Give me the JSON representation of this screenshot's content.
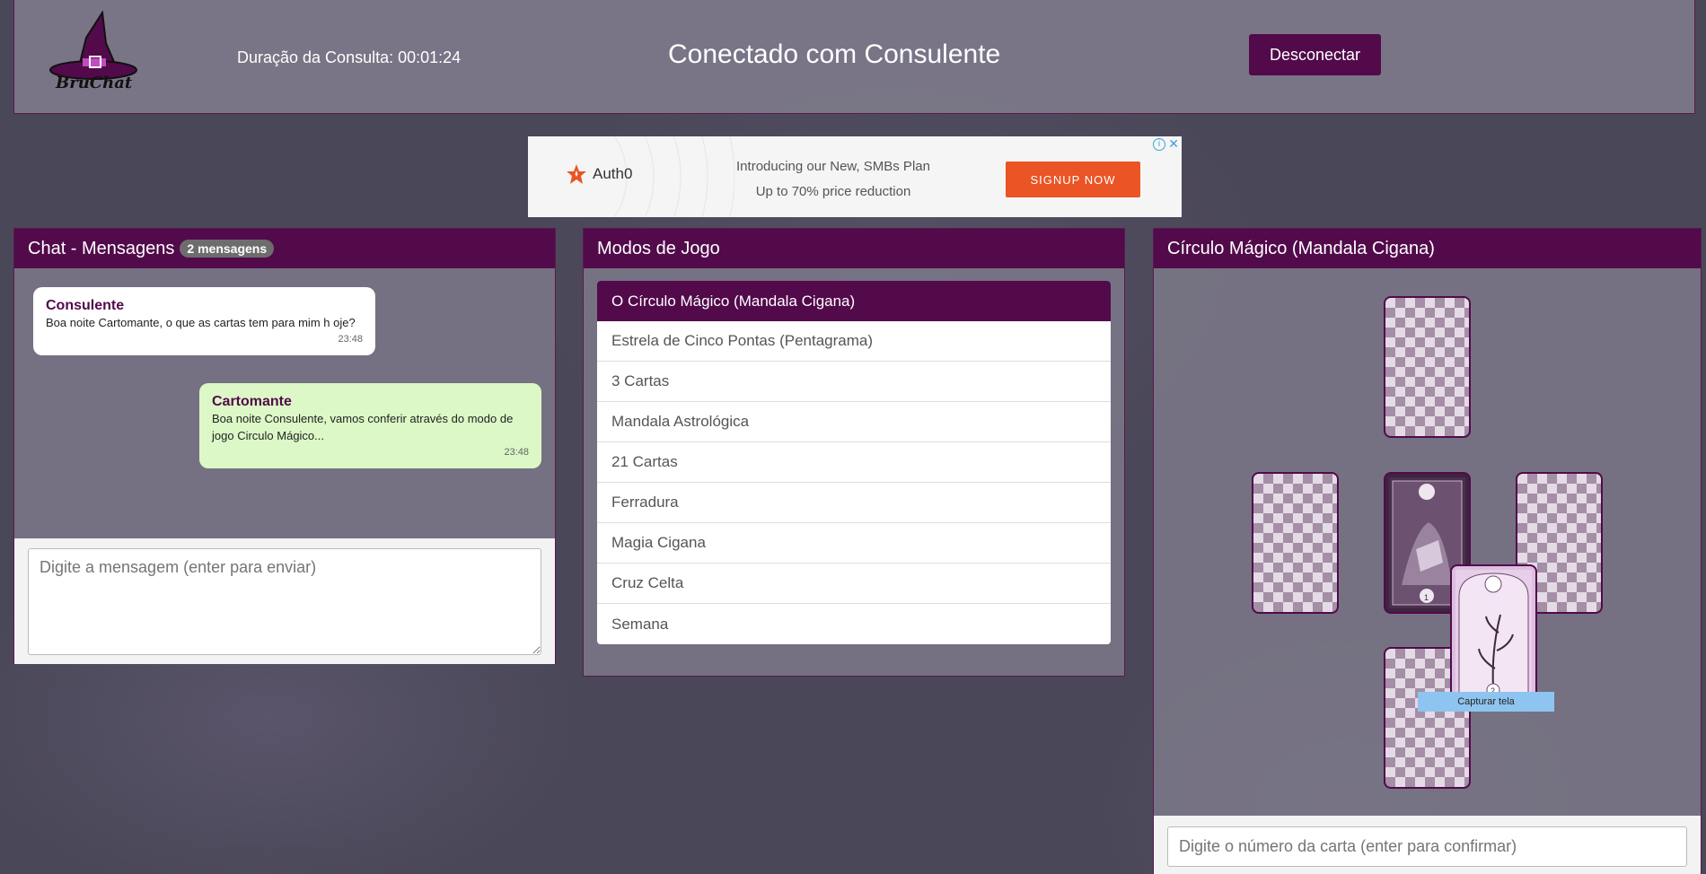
{
  "header": {
    "logo_text": "BruChat",
    "duration_label": "Duração da Consulta: 00:01:24",
    "title": "Conectado com Consulente",
    "disconnect_label": "Desconectar"
  },
  "ad": {
    "brand": "Auth0",
    "line1": "Introducing our New, SMBs Plan",
    "line2": "Up to 70% price reduction",
    "cta": "SIGNUP NOW",
    "brand_color": "#eb5424"
  },
  "chat": {
    "title": "Chat - Mensagens",
    "badge": "2 mensagens",
    "messages": [
      {
        "author": "Consulente",
        "text": "Boa noite Cartomante, o que as cartas tem para mim h oje?",
        "time": "23:48"
      },
      {
        "author": "Cartomante",
        "text": "Boa noite Consulente, vamos conferir através do modo de jogo Circulo Mágico...",
        "time": "23:48"
      }
    ],
    "input_placeholder": "Digite a mensagem (enter para enviar)"
  },
  "modes": {
    "title": "Modos de Jogo",
    "items": [
      {
        "label": "O Círculo Mágico (Mandala Cigana)",
        "active": true
      },
      {
        "label": "Estrela de Cinco Pontas (Pentagrama)",
        "active": false
      },
      {
        "label": "3 Cartas",
        "active": false
      },
      {
        "label": "Mandala Astrológica",
        "active": false
      },
      {
        "label": "21 Cartas",
        "active": false
      },
      {
        "label": "Ferradura",
        "active": false
      },
      {
        "label": "Magia Cigana",
        "active": false
      },
      {
        "label": "Cruz Celta",
        "active": false
      },
      {
        "label": "Semana",
        "active": false
      }
    ]
  },
  "board": {
    "title": "Círculo Mágico (Mandala Cigana)",
    "card1_number": "1",
    "card2_number": "2",
    "capture_label": "Capturar tela",
    "input_placeholder": "Digite o número da carta (enter para confirmar)"
  },
  "colors": {
    "primary": "#520a4b",
    "user_bubble": "#dcf8c6"
  }
}
